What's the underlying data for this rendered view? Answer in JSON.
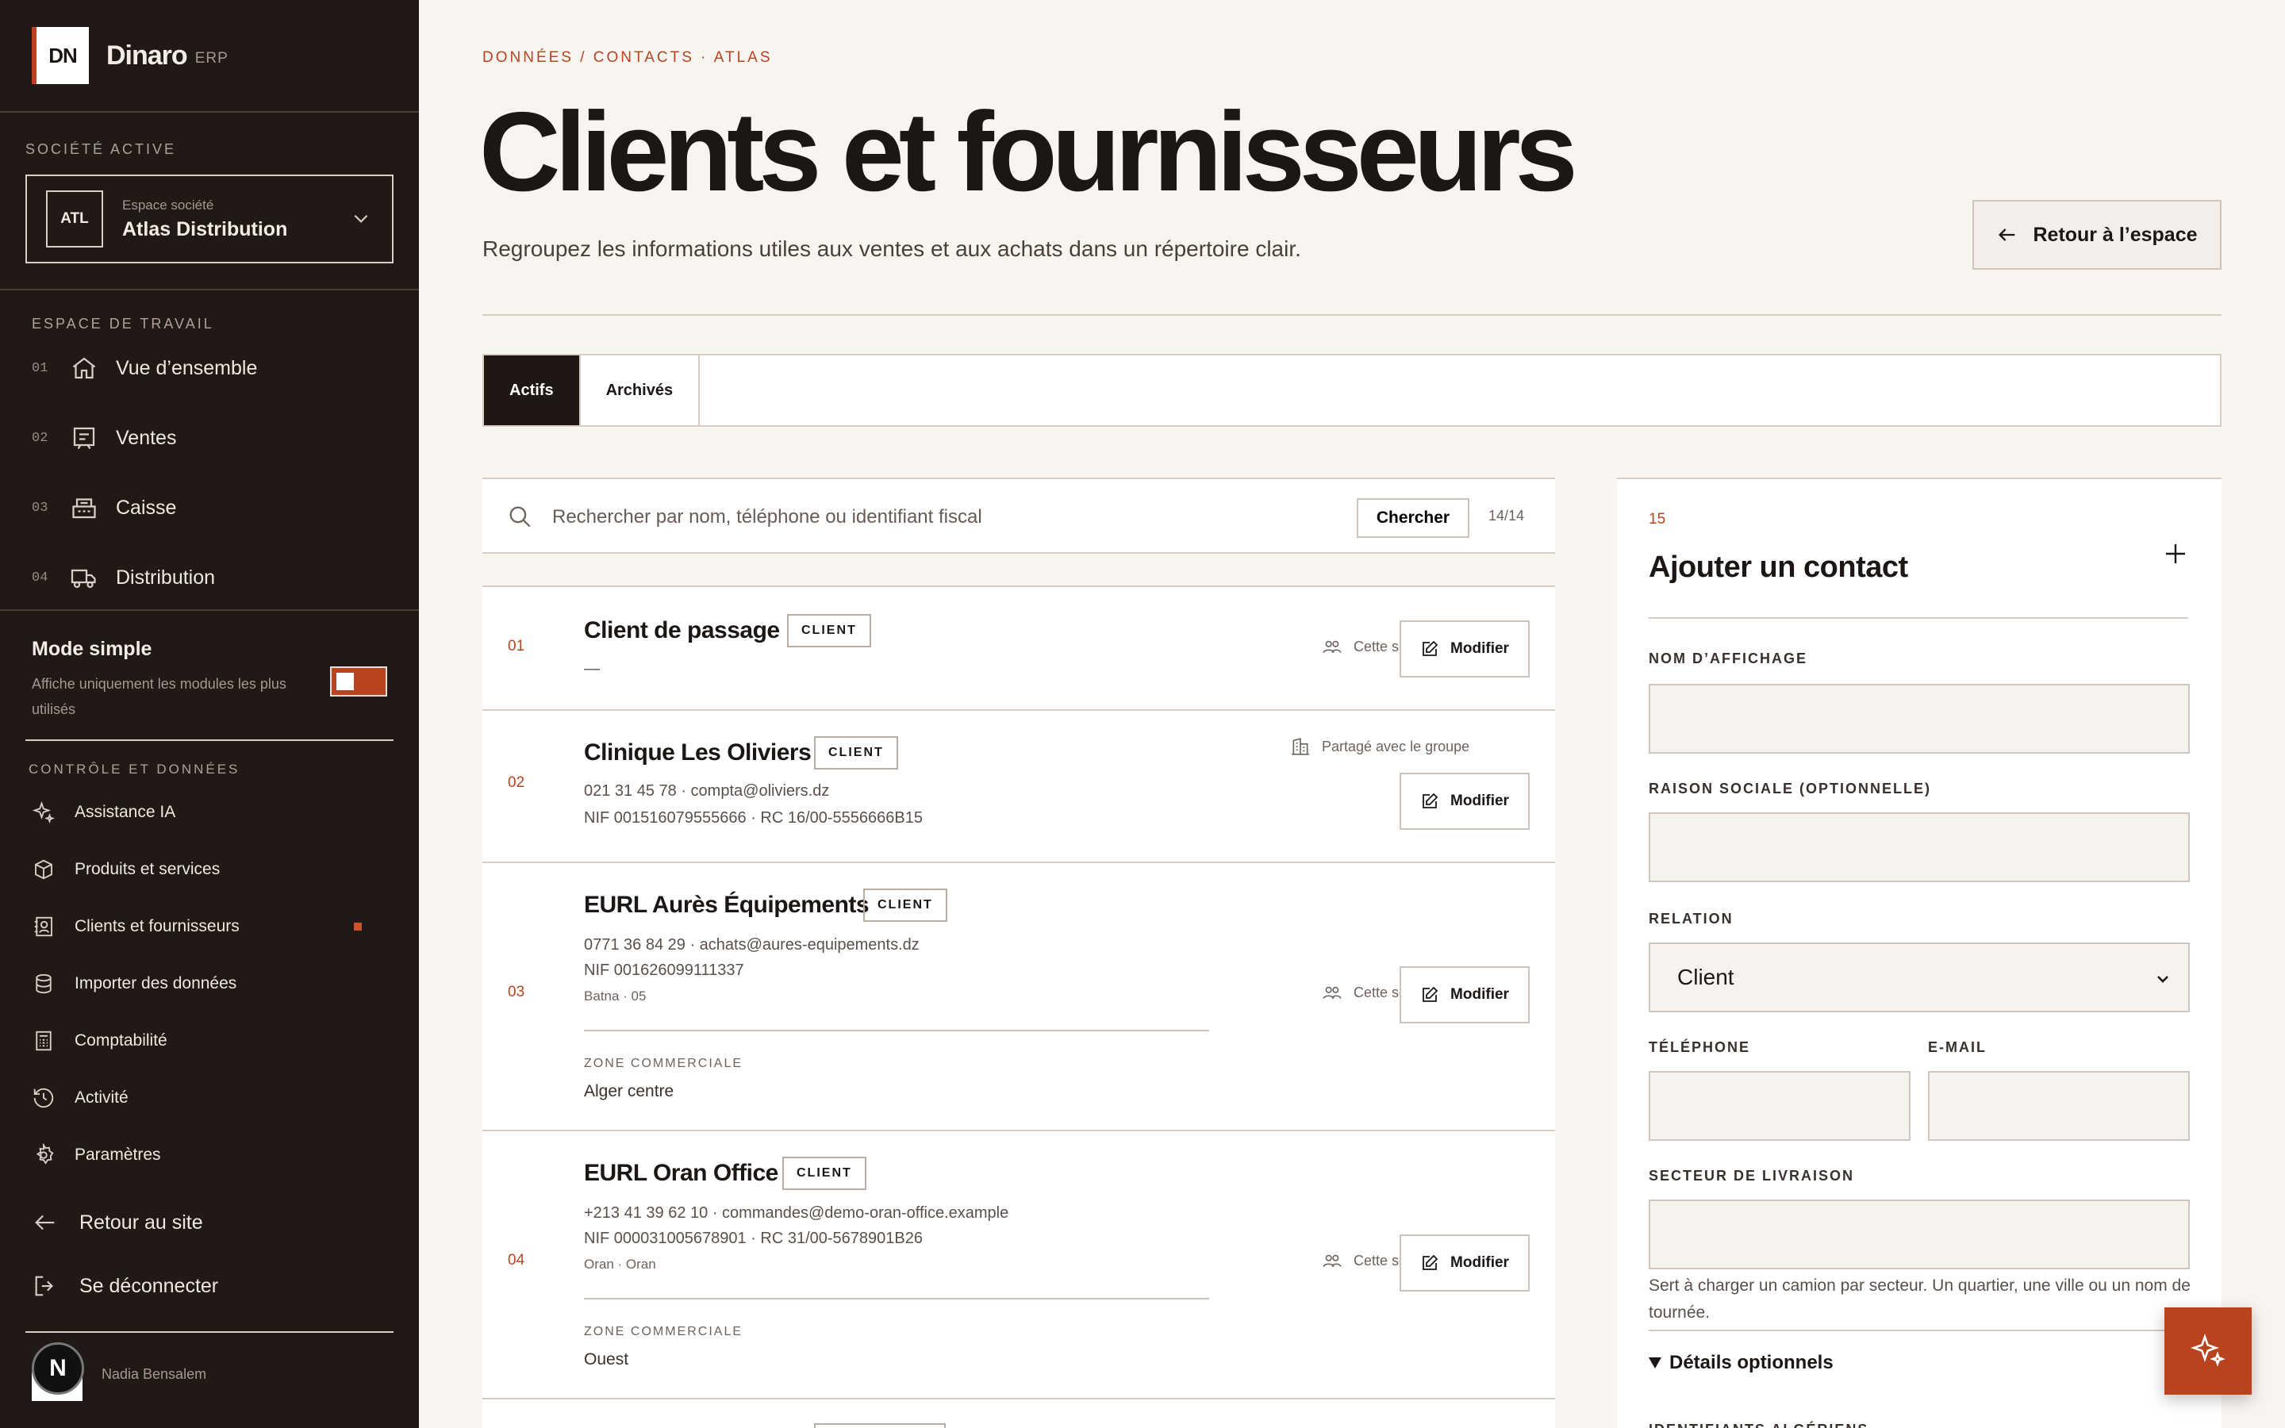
{
  "brand": {
    "logo": "DN",
    "name": "Dinaro",
    "suffix": "ERP"
  },
  "company": {
    "section_label": "SOCIÉTÉ ACTIVE",
    "badge": "ATL",
    "field_label": "Espace société",
    "name": "Atlas Distribution",
    "chevron_icon": "chevron-down-icon"
  },
  "workspace": {
    "section_label": "ESPACE DE TRAVAIL",
    "items": [
      {
        "num": "01",
        "label": "Vue d’ensemble",
        "icon": "home-icon"
      },
      {
        "num": "02",
        "label": "Ventes",
        "icon": "receipt-icon"
      },
      {
        "num": "03",
        "label": "Caisse",
        "icon": "register-icon"
      },
      {
        "num": "04",
        "label": "Distribution",
        "icon": "truck-icon"
      }
    ]
  },
  "simple_mode": {
    "title": "Mode simple",
    "description": "Affiche uniquement les modules les plus utilisés",
    "enabled": true
  },
  "controls": {
    "section_label": "CONTRÔLE ET DONNÉES",
    "items": [
      {
        "label": "Assistance IA",
        "icon": "sparkle-icon"
      },
      {
        "label": "Produits et services",
        "icon": "box-icon"
      },
      {
        "label": "Clients et fournisseurs",
        "icon": "contacts-icon",
        "active": true
      },
      {
        "label": "Importer des données",
        "icon": "database-icon"
      },
      {
        "label": "Comptabilité",
        "icon": "calculator-icon"
      },
      {
        "label": "Activité",
        "icon": "history-icon"
      },
      {
        "label": "Paramètres",
        "icon": "gear-icon"
      }
    ]
  },
  "footer": {
    "back_label": "Retour au site",
    "logout_label": "Se déconnecter"
  },
  "user": {
    "initial": "N",
    "name": "Nadia Bensalem"
  },
  "page": {
    "breadcrumb": "DONNÉES / CONTACTS · ATLAS",
    "title": "Clients et fournisseurs",
    "subtitle": "Regroupez les informations utiles aux ventes et aux achats dans un répertoire clair.",
    "back_button": "Retour à l’espace"
  },
  "tabs": [
    {
      "label": "Actifs",
      "active": true
    },
    {
      "label": "Archivés",
      "active": false
    }
  ],
  "search": {
    "placeholder": "Rechercher par nom, téléphone ou identifiant fiscal",
    "value": "",
    "button": "Chercher",
    "count": "14/14"
  },
  "contacts": [
    {
      "num": "01",
      "name": "Client de passage",
      "tag": "CLIENT",
      "line1": "—",
      "share": "Cette société",
      "edit": "Modifier"
    },
    {
      "num": "02",
      "name": "Clinique Les Oliviers",
      "tag": "CLIENT",
      "line1": "021 31 45 78 · compta@oliviers.dz",
      "line2": "NIF 001516079555666 · RC 16/00-5556666B15",
      "share": "Partagé avec le groupe",
      "edit": "Modifier"
    },
    {
      "num": "03",
      "name": "EURL Aurès Équipements",
      "tag": "CLIENT",
      "line1": "0771 36 84 29 · achats@aures-equipements.dz",
      "line2": "NIF 001626099111337",
      "location": "Batna · 05",
      "zone_label": "ZONE COMMERCIALE",
      "zone": "Alger centre",
      "share": "Cette société",
      "edit": "Modifier"
    },
    {
      "num": "04",
      "name": "EURL Oran Office",
      "tag": "CLIENT",
      "line1": "+213 41 39 62 10 · commandes@demo-oran-office.example",
      "line2": "NIF 000031005678901 · RC 31/00-5678901B26",
      "location": "Oran · Oran",
      "zone_label": "ZONE COMMERCIALE",
      "zone": "Ouest",
      "share": "Cette société",
      "edit": "Modifier"
    }
  ],
  "form": {
    "number": "15",
    "title": "Ajouter un contact",
    "display_name_label": "NOM D’AFFICHAGE",
    "display_name_value": "",
    "legal_name_label": "RAISON SOCIALE (OPTIONNELLE)",
    "legal_name_value": "",
    "relation_label": "RELATION",
    "relation_value": "Client",
    "phone_label": "TÉLÉPHONE",
    "phone_value": "",
    "email_label": "E-MAIL",
    "email_value": "",
    "sector_label": "SECTEUR DE LIVRAISON",
    "sector_value": "",
    "sector_help": "Sert à charger un camion par secteur. Un quartier, une ville ou un nom de tournée.",
    "details_label": "Détails optionnels",
    "next_label": "IDENTIFIANTS ALGÉRIENS"
  },
  "colors": {
    "sidebar_bg": "#211916",
    "page_bg": "#f8f5f1",
    "accent": "#b8431f",
    "text": "#1c1714"
  }
}
